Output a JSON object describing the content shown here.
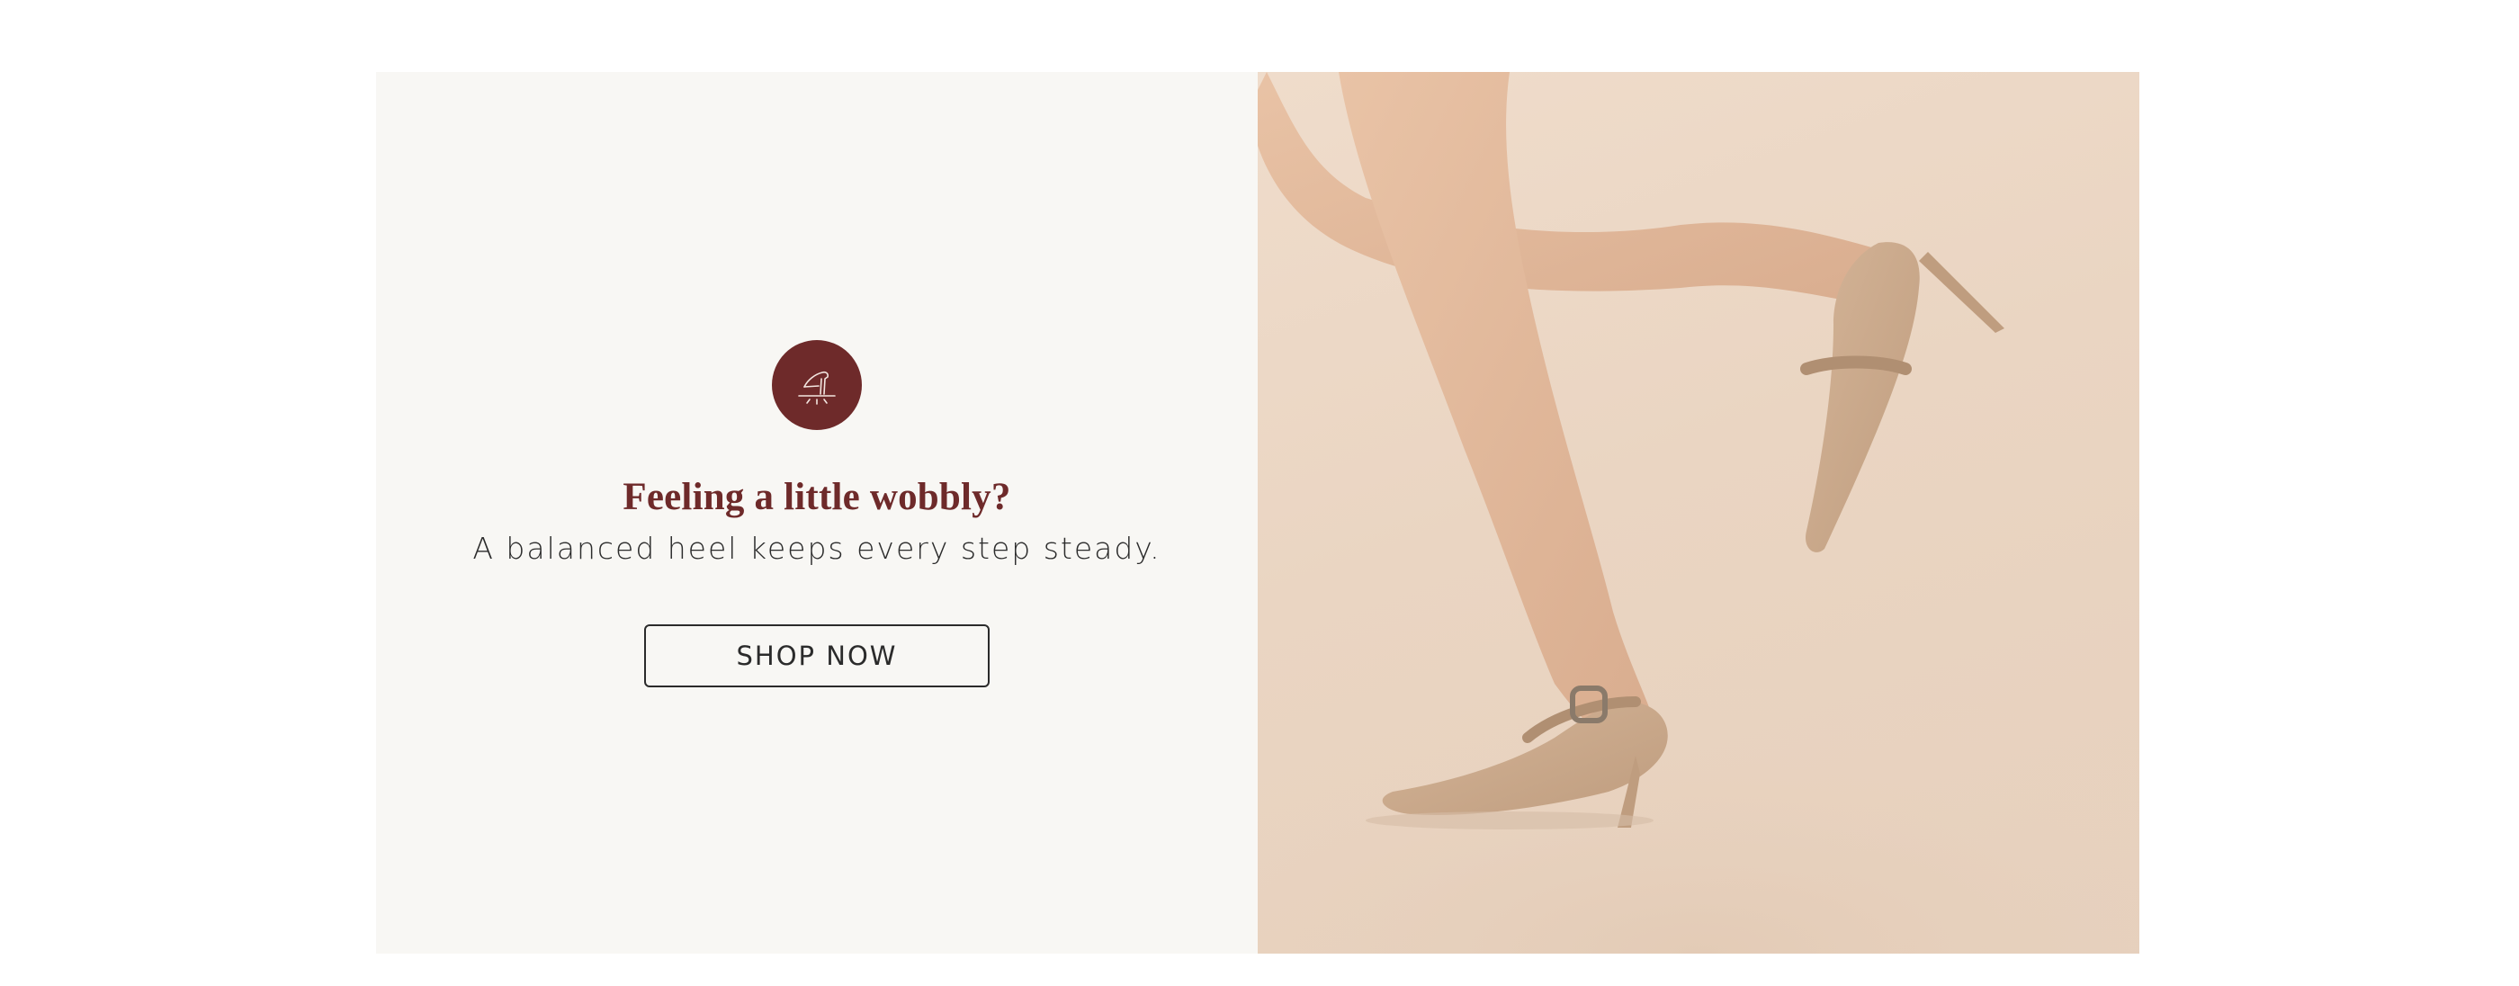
{
  "promo": {
    "headline": "Feeling a little wobbly?",
    "subline": "A balanced heel keeps every step steady.",
    "button_label": "SHOP NOW",
    "badge_icon": "balanced-heel-icon",
    "photo": "legs-in-nude-pointed-heel-mules"
  },
  "colors": {
    "accent": "#6e2a2a",
    "panel_background": "#f8f7f4",
    "text": "#2b2b2b",
    "photo_background": "#ead5c2",
    "shoe": "#c9a98a"
  }
}
